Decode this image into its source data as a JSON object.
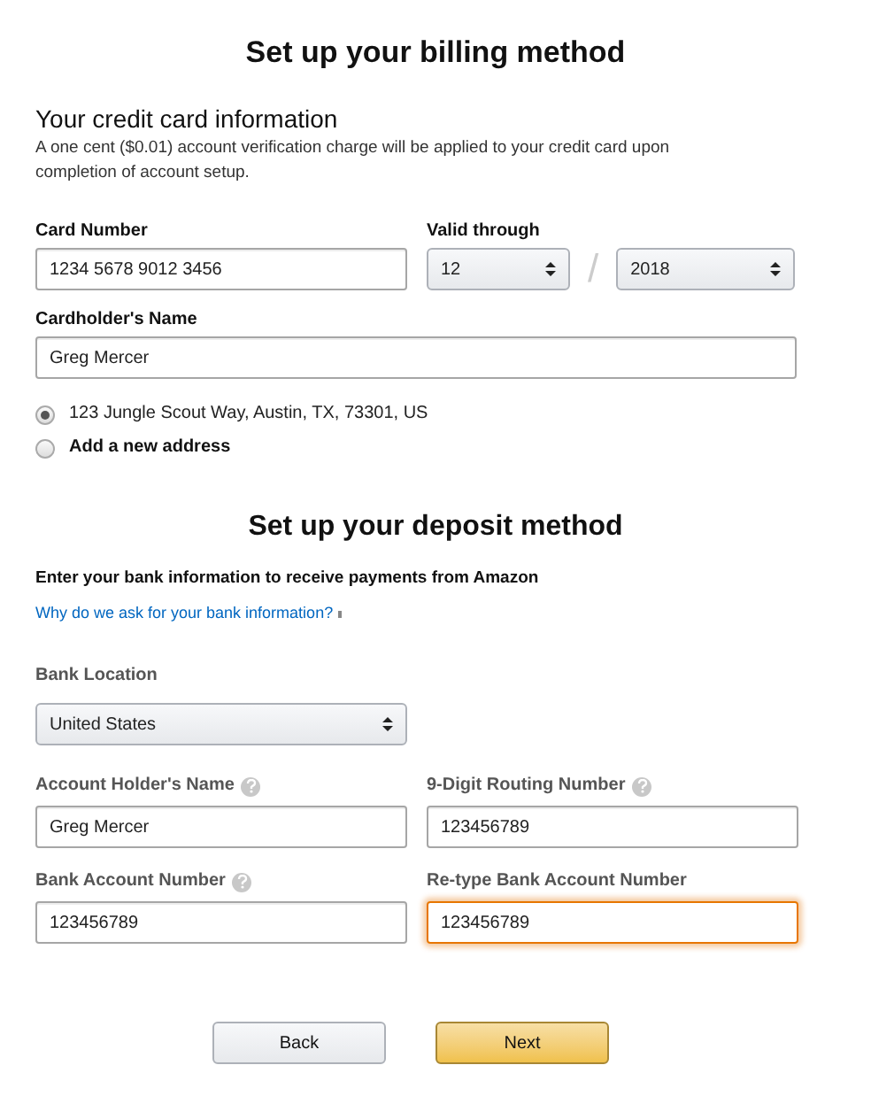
{
  "billing": {
    "title": "Set up your billing method",
    "subtitle": "Your credit card information",
    "note": "A one cent ($0.01) account verification charge will be applied to your credit card upon completion of account setup.",
    "card_number": {
      "label": "Card Number",
      "value": "1234 5678 9012 3456",
      "focused": false
    },
    "valid_through": {
      "label": "Valid through",
      "month": "12",
      "separator": "/",
      "year": "2018"
    },
    "cardholder_name": {
      "label": "Cardholder's Name",
      "value": "Greg Mercer",
      "focused": false
    },
    "addresses": [
      {
        "label": "123 Jungle Scout Way, Austin, TX, 73301, US",
        "bold": false,
        "selected": true
      },
      {
        "label": "Add a new address",
        "bold": true,
        "selected": false
      }
    ]
  },
  "deposit": {
    "title": "Set up your deposit method",
    "intro": "Enter your bank information to receive payments from Amazon",
    "link": "Why do we ask for your bank information?",
    "bank_location": {
      "label": "Bank Location",
      "value": "United States"
    },
    "fields": [
      {
        "label": "Account Holder's Name",
        "help": true,
        "value": "Greg Mercer",
        "focused": false
      },
      {
        "label": "9-Digit Routing Number",
        "help": true,
        "value": "123456789",
        "focused": false
      },
      {
        "label": "Bank Account Number",
        "help": true,
        "value": "123456789",
        "focused": false
      },
      {
        "label": "Re-type Bank Account Number",
        "help": false,
        "value": "123456789",
        "focused": true
      }
    ]
  },
  "buttons": [
    {
      "label": "Back",
      "kind": "secondary"
    },
    {
      "label": "Next",
      "kind": "primary"
    }
  ]
}
